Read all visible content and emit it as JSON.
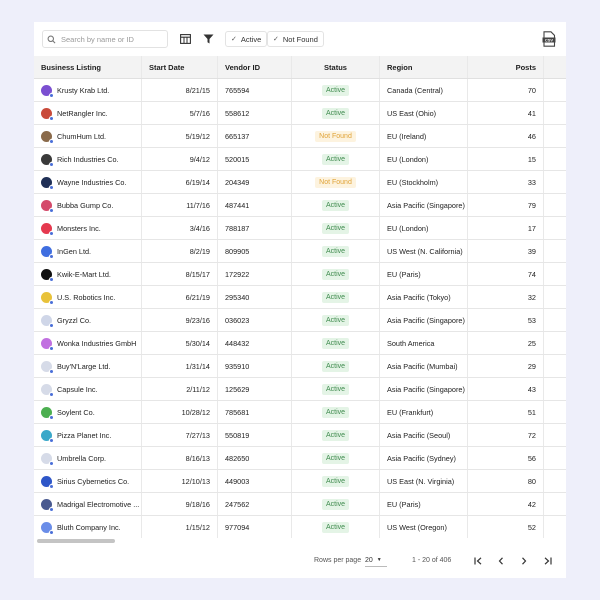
{
  "toolbar": {
    "search_placeholder": "Search by name or ID",
    "filter_chips": [
      {
        "label": "Active"
      },
      {
        "label": "Not Found"
      }
    ]
  },
  "table": {
    "columns": [
      "Business Listing",
      "Start Date",
      "Vendor ID",
      "Status",
      "Region",
      "Posts"
    ],
    "rows": [
      {
        "name": "Krusty Krab Ltd.",
        "date": "8/21/15",
        "vendor": "765594",
        "status": "Active",
        "region": "Canada (Central)",
        "posts": "70",
        "avatar_color": "#7b4fd1"
      },
      {
        "name": "NetRangler Inc.",
        "date": "5/7/16",
        "vendor": "558612",
        "status": "Active",
        "region": "US East (Ohio)",
        "posts": "41",
        "avatar_color": "#c94a3a"
      },
      {
        "name": "ChumHum Ltd.",
        "date": "5/19/12",
        "vendor": "665137",
        "status": "Not Found",
        "region": "EU (Ireland)",
        "posts": "46",
        "avatar_color": "#8a6a4a"
      },
      {
        "name": "Rich Industries Co.",
        "date": "9/4/12",
        "vendor": "520015",
        "status": "Active",
        "region": "EU (London)",
        "posts": "15",
        "avatar_color": "#3a3a3a"
      },
      {
        "name": "Wayne Industries Co.",
        "date": "6/19/14",
        "vendor": "204349",
        "status": "Not Found",
        "region": "EU (Stockholm)",
        "posts": "33",
        "avatar_color": "#1f2f55"
      },
      {
        "name": "Bubba Gump Co.",
        "date": "11/7/16",
        "vendor": "487441",
        "status": "Active",
        "region": "Asia Pacific (Singapore)",
        "posts": "79",
        "avatar_color": "#d44a6a"
      },
      {
        "name": "Monsters Inc.",
        "date": "3/4/16",
        "vendor": "788187",
        "status": "Active",
        "region": "EU (London)",
        "posts": "17",
        "avatar_color": "#e5394f"
      },
      {
        "name": "InGen Ltd.",
        "date": "8/2/19",
        "vendor": "809905",
        "status": "Active",
        "region": "US West (N. California)",
        "posts": "39",
        "avatar_color": "#3f6ee0"
      },
      {
        "name": "Kwik-E-Mart Ltd.",
        "date": "8/15/17",
        "vendor": "172922",
        "status": "Active",
        "region": "EU (Paris)",
        "posts": "74",
        "avatar_color": "#101010"
      },
      {
        "name": "U.S. Robotics Inc.",
        "date": "6/21/19",
        "vendor": "295340",
        "status": "Active",
        "region": "Asia Pacific (Tokyo)",
        "posts": "32",
        "avatar_color": "#e8c23a"
      },
      {
        "name": "Gryzzl Co.",
        "date": "9/23/16",
        "vendor": "036023",
        "status": "Active",
        "region": "Asia Pacific (Singapore)",
        "posts": "53",
        "avatar_color": "#cfd6e8"
      },
      {
        "name": "Wonka Industries GmbH",
        "date": "5/30/14",
        "vendor": "448432",
        "status": "Active",
        "region": "South America",
        "posts": "25",
        "avatar_color": "#c170e0"
      },
      {
        "name": "Buy'N'Large Ltd.",
        "date": "1/31/14",
        "vendor": "935910",
        "status": "Active",
        "region": "Asia Pacific (Mumbai)",
        "posts": "29",
        "avatar_color": "#d6dbe8"
      },
      {
        "name": "Capsule Inc.",
        "date": "2/11/12",
        "vendor": "125629",
        "status": "Active",
        "region": "Asia Pacific (Singapore)",
        "posts": "43",
        "avatar_color": "#d6dbe8"
      },
      {
        "name": "Soylent Co.",
        "date": "10/28/12",
        "vendor": "785681",
        "status": "Active",
        "region": "EU (Frankfurt)",
        "posts": "51",
        "avatar_color": "#4caf50"
      },
      {
        "name": "Pizza Planet  Inc.",
        "date": "7/27/13",
        "vendor": "550819",
        "status": "Active",
        "region": "Asia Pacific (Seoul)",
        "posts": "72",
        "avatar_color": "#3aa8c9"
      },
      {
        "name": "Umbrella Corp.",
        "date": "8/16/13",
        "vendor": "482650",
        "status": "Active",
        "region": "Asia Pacific (Sydney)",
        "posts": "56",
        "avatar_color": "#d6dbe8"
      },
      {
        "name": "Sirius Cybernetics Co.",
        "date": "12/10/13",
        "vendor": "449003",
        "status": "Active",
        "region": "US East (N. Virginia)",
        "posts": "80",
        "avatar_color": "#2e56c8"
      },
      {
        "name": "Madrigal Electromotive ...",
        "date": "9/18/16",
        "vendor": "247562",
        "status": "Active",
        "region": "EU (Paris)",
        "posts": "42",
        "avatar_color": "#4a5a90"
      },
      {
        "name": "Bluth Company Inc.",
        "date": "1/15/12",
        "vendor": "977094",
        "status": "Active",
        "region": "US West (Oregon)",
        "posts": "52",
        "avatar_color": "#6a8de8"
      }
    ]
  },
  "footer": {
    "rows_per_page_label": "Rows per page",
    "rows_per_page_value": "20",
    "range_text": "1 - 20 of 406"
  },
  "colors": {
    "background": "#eeeffa",
    "active_bg": "#e4f4e6",
    "active_text": "#3f8b4e",
    "notfound_bg": "#fdf3df",
    "notfound_text": "#e0a337",
    "vendor_dot": "#4a6fd8"
  },
  "icons": {
    "search": "search-icon",
    "columns": "columns-icon",
    "filter": "filter-icon",
    "check": "check-icon",
    "export": "csv-export-icon",
    "first_page": "first-page-icon",
    "prev_page": "chevron-left-icon",
    "next_page": "chevron-right-icon",
    "last_page": "last-page-icon"
  }
}
